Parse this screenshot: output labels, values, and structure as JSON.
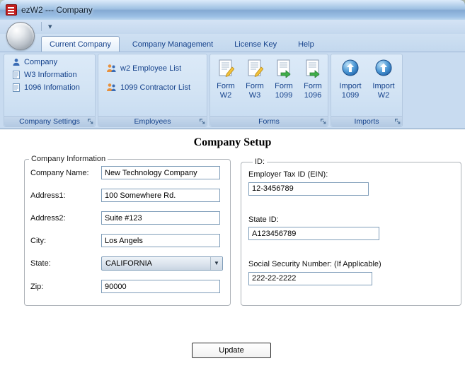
{
  "window": {
    "title": "ezW2 --- Company"
  },
  "colors": {
    "accent": "#15428b",
    "logo_red": "#c21f1f",
    "ribbon_bg": "#c8dbf0",
    "input_border": "#7f9db9"
  },
  "icons": {
    "chevron_down": "▾",
    "combo_arrow": "▼"
  },
  "tabs": [
    {
      "label": "Current Company",
      "active": true
    },
    {
      "label": "Company Management",
      "active": false
    },
    {
      "label": "License Key",
      "active": false
    },
    {
      "label": "Help",
      "active": false
    }
  ],
  "ribbon": {
    "groups": [
      {
        "caption": "Company Settings",
        "items": [
          {
            "label": "Company",
            "icon": "person-icon"
          },
          {
            "label": "W3 Information",
            "icon": "document-icon"
          },
          {
            "label": "1096 Infomation",
            "icon": "document-icon"
          }
        ]
      },
      {
        "caption": "Employees",
        "items": [
          {
            "label": "w2 Employee List",
            "icon": "people-icon"
          },
          {
            "label": "1099 Contractor List",
            "icon": "people-icon"
          }
        ]
      },
      {
        "caption": "Forms",
        "items": [
          {
            "line1": "Form",
            "line2": "W2",
            "icon": "form-edit-icon"
          },
          {
            "line1": "Form",
            "line2": "W3",
            "icon": "form-edit-icon"
          },
          {
            "line1": "Form",
            "line2": "1099",
            "icon": "form-arrow-icon"
          },
          {
            "line1": "Form",
            "line2": "1096",
            "icon": "form-arrow-icon"
          }
        ]
      },
      {
        "caption": "Imports",
        "items": [
          {
            "line1": "Import",
            "line2": "1099",
            "icon": "import-icon"
          },
          {
            "line1": "Import",
            "line2": "W2",
            "icon": "import-icon"
          }
        ]
      }
    ]
  },
  "main": {
    "page_title": "Company Setup",
    "company_info": {
      "legend": "Company Information",
      "fields": [
        {
          "label": "Company Name:",
          "value": "New Technology Company"
        },
        {
          "label": "Address1:",
          "value": "100 Somewhere Rd."
        },
        {
          "label": "Address2:",
          "value": "Suite #123"
        },
        {
          "label": "City:",
          "value": "Los Angels"
        },
        {
          "label": "State:",
          "value": "CALIFORNIA"
        },
        {
          "label": "Zip:",
          "value": "90000"
        }
      ]
    },
    "id_info": {
      "legend": "ID:",
      "fields": [
        {
          "label": "Employer Tax ID (EIN):",
          "value": "12-3456789"
        },
        {
          "label": "State ID:",
          "value": "A123456789"
        },
        {
          "label": "Social Security Number: (If Applicable)",
          "value": "222-22-2222"
        }
      ]
    },
    "update_button": "Update"
  }
}
